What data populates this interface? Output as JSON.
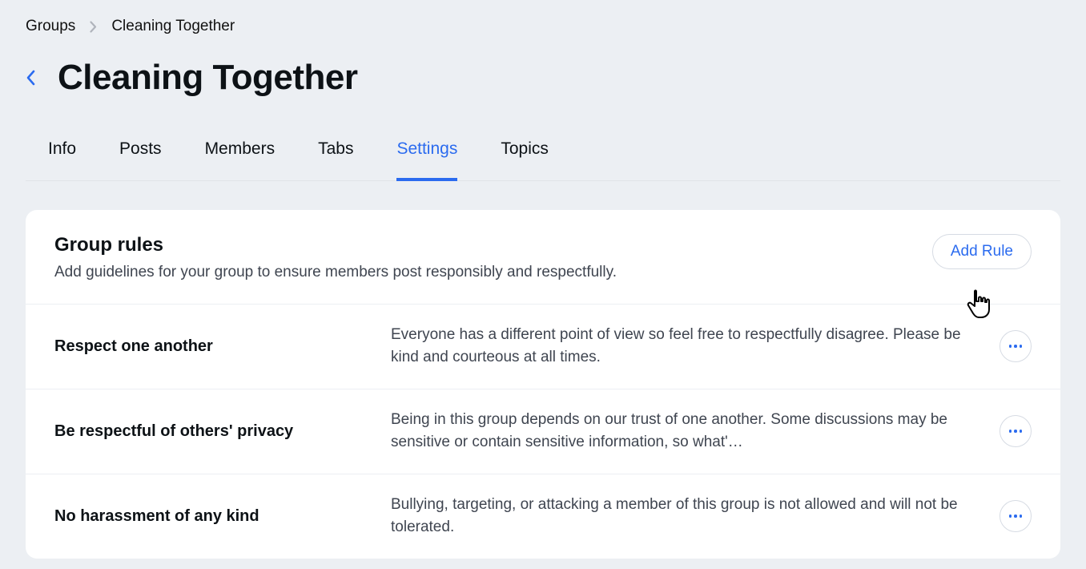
{
  "breadcrumb": {
    "root": "Groups",
    "current": "Cleaning Together"
  },
  "page_title": "Cleaning Together",
  "tabs": [
    {
      "label": "Info",
      "active": false
    },
    {
      "label": "Posts",
      "active": false
    },
    {
      "label": "Members",
      "active": false
    },
    {
      "label": "Tabs",
      "active": false
    },
    {
      "label": "Settings",
      "active": true
    },
    {
      "label": "Topics",
      "active": false
    }
  ],
  "rules_section": {
    "title": "Group rules",
    "subtitle": "Add guidelines for your group to ensure members post responsibly and respectfully.",
    "add_button_label": "Add Rule",
    "rules": [
      {
        "title": "Respect one another",
        "description": "Everyone has a different point of view so feel free to respectfully disagree. Please be kind and courteous at all times."
      },
      {
        "title": "Be respectful of others' privacy",
        "description": "Being in this group depends on our trust of one another. Some discussions may be sensitive or contain sensitive information, so what'…"
      },
      {
        "title": "No harassment of any kind",
        "description": "Bullying, targeting, or attacking a member of this group is not allowed and will not be tolerated."
      }
    ]
  }
}
